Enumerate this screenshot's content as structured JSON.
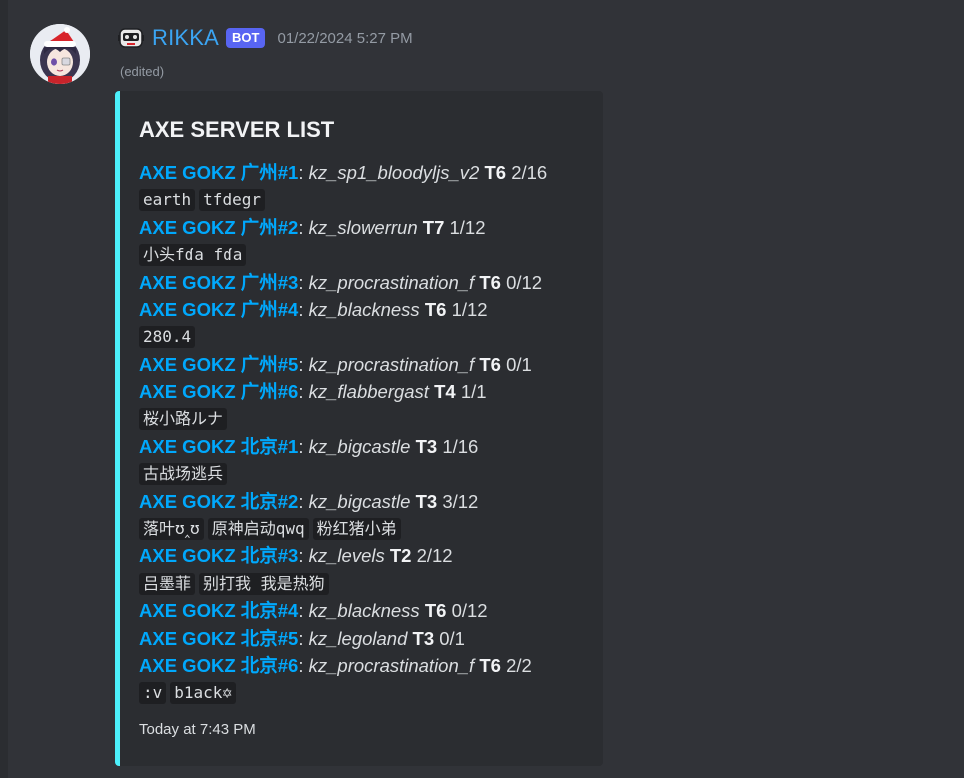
{
  "message": {
    "author": "RIKKA",
    "bot_tag": "BOT",
    "timestamp": "01/22/2024 5:27 PM",
    "edited": "(edited)"
  },
  "embed": {
    "title": "AXE SERVER LIST",
    "accent_color": "#4cf0fb",
    "footer": "Today at 7:43 PM",
    "servers": [
      {
        "name": "AXE GOKZ 广州#1",
        "map": "kz_sp1_bloodyljs_v2",
        "tier": "T6",
        "count": "2/16",
        "players": [
          "earth",
          "tfdegr"
        ]
      },
      {
        "name": "AXE GOKZ 广州#2",
        "map": "kz_slowerrun",
        "tier": "T7",
        "count": "1/12",
        "players": [
          "小头fɗa fɗa"
        ]
      },
      {
        "name": "AXE GOKZ 广州#3",
        "map": "kz_procrastination_f",
        "tier": "T6",
        "count": "0/12",
        "players": []
      },
      {
        "name": "AXE GOKZ 广州#4",
        "map": "kz_blackness",
        "tier": "T6",
        "count": "1/12",
        "players": [
          "280.4"
        ]
      },
      {
        "name": "AXE GOKZ 广州#5",
        "map": "kz_procrastination_f",
        "tier": "T6",
        "count": "0/1",
        "players": []
      },
      {
        "name": "AXE GOKZ 广州#6",
        "map": "kz_flabbergast",
        "tier": "T4",
        "count": "1/1",
        "players": [
          "桜小路ルナ"
        ]
      },
      {
        "name": "AXE GOKZ 北京#1",
        "map": "kz_bigcastle",
        "tier": "T3",
        "count": "1/16",
        "players": [
          "古战场逃兵"
        ]
      },
      {
        "name": "AXE GOKZ 北京#2",
        "map": "kz_bigcastle",
        "tier": "T3",
        "count": "3/12",
        "players": [
          "落叶ʊ‸ʊ",
          "原神启动qwq",
          "粉红猪小弟"
        ]
      },
      {
        "name": "AXE GOKZ 北京#3",
        "map": "kz_levels",
        "tier": "T2",
        "count": "2/12",
        "players": [
          "吕墨菲",
          "别打我 我是热狗"
        ]
      },
      {
        "name": "AXE GOKZ 北京#4",
        "map": "kz_blackness",
        "tier": "T6",
        "count": "0/12",
        "players": []
      },
      {
        "name": "AXE GOKZ 北京#5",
        "map": "kz_legoland",
        "tier": "T3",
        "count": "0/1",
        "players": []
      },
      {
        "name": "AXE GOKZ 北京#6",
        "map": "kz_procrastination_f",
        "tier": "T6",
        "count": "2/2",
        "players": [
          ":v",
          "b1ack✡"
        ]
      }
    ]
  },
  "icons": {
    "avatar": "anime-avatar-santa-hat",
    "bot_face": "robot-face-icon"
  }
}
